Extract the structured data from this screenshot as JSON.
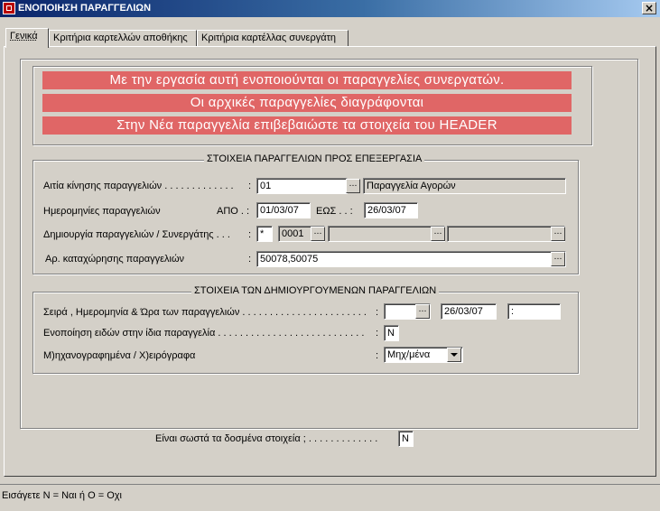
{
  "window": {
    "title": "ΕΝΟΠΟΙΗΣΗ ΠΑΡΑΓΓΕΛΙΩΝ",
    "close": "×"
  },
  "tabs": [
    {
      "label": "Γενικά"
    },
    {
      "label": "Κριτήρια καρτελλών αποθήκης"
    },
    {
      "label": "Κριτήρια καρτέλλας συνεργάτη"
    }
  ],
  "banners": [
    "Με την εργασία αυτή ενοποιούνται οι παραγγελίες συνεργατών.",
    "Οι αρχικές παραγγελίες διαγράφονται",
    "Στην Νέα παραγγελία επιβεβαιώστε τα στοιχεία του HEADER"
  ],
  "group1": {
    "title": "ΣΤΟΙΧΕΙΑ ΠΑΡΑΓΓΕΛΙΩΝ ΠΡΟΣ ΕΠΕΞΕΡΓΑΣΙΑ",
    "reason_label": "Αιτία κίνησης παραγγελιών . . . . . . . . . . . . .",
    "reason_code": "01",
    "reason_desc": "Παραγγελία Αγορών",
    "dates_label": "Ημερομηνίες παραγγελιών",
    "from_label": "ΑΠΟ . :",
    "from_date": "01/03/07",
    "to_label": "ΕΩΣ . . :",
    "to_date": "26/03/07",
    "create_label": "Δημιουργία παραγγελιών / Συνεργάτης . . .",
    "create_flag": "*",
    "partner_code": "0001",
    "partner_name": "",
    "partner_extra": "",
    "reg_label": "Αρ. καταχώρησης παραγγελιών",
    "reg_numbers": "50078,50075"
  },
  "group2": {
    "title": "ΣΤΟΙΧΕΙΑ ΤΩΝ ΔΗΜΙΟΥΡΓΟΥΜΕΝΩΝ ΠΑΡΑΓΓΕΛΙΩΝ",
    "series_label": "Σειρά , Ημερομηνία & Ώρα των παραγγελιών . . . . . . . . . . . . . . . . . . . . . . .",
    "series_value": "",
    "date_value": "26/03/07",
    "time_value": ":",
    "merge_label": "Ενοποίηση ειδών στην ίδια παραγγελία . . . . . . . . . . . . . . . . . . . . . . . . . . .",
    "merge_value": "Ν",
    "mode_label": "Μ)ηχανογραφημένα / Χ)ειρόγραφα",
    "mode_value": "Μηχ/μένα"
  },
  "confirm": {
    "label": "Είναι σωστά τα δοσμένα στοιχεία ; . . . . . . . . . . . . .",
    "value": "Ν"
  },
  "status": {
    "text": "Εισάγετε Ν = Ναι  ή  Ο = Οχι"
  },
  "colors": {
    "banner_bg": "#e06666",
    "titlebar_start": "#0a246a",
    "face": "#d4d0c8"
  },
  "common": {
    "colon": ":",
    "ellipsis": "…"
  }
}
